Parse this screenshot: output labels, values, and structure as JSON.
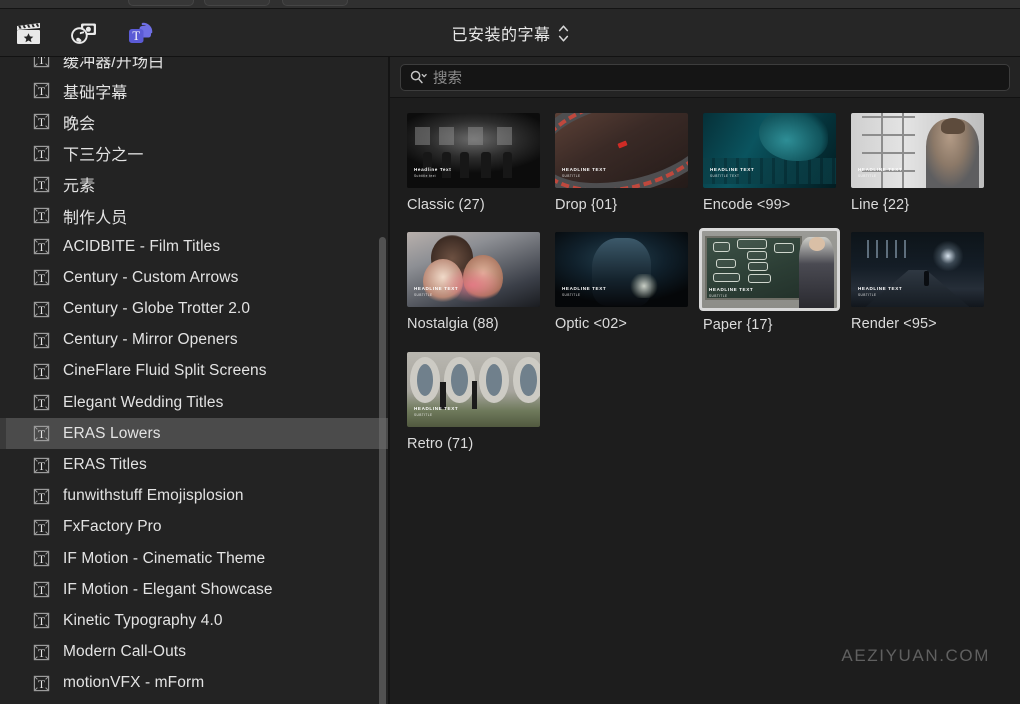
{
  "window": {
    "app_theme_bg": "#1b1b1b",
    "accent_color": "#5b5bd6"
  },
  "toolbar": {
    "icons": [
      {
        "name": "media-clapperboard-icon",
        "label": "照片和视频"
      },
      {
        "name": "audio-photos-icon",
        "label": "音频和照片"
      },
      {
        "name": "titles-generators-icon",
        "label": "字幕和发生器",
        "active": true
      }
    ],
    "browser_title": "已安装的字幕",
    "browser_title_chevron": "chevron-up-down"
  },
  "sidebar": {
    "scroll_position": "middle",
    "items": [
      {
        "label": "缓冲器/开场白",
        "icon": "title-T-icon",
        "selected": false,
        "cjk": true,
        "clipped": true
      },
      {
        "label": "基础字幕",
        "icon": "title-T-icon",
        "selected": false,
        "cjk": true
      },
      {
        "label": "晚会",
        "icon": "title-T-icon",
        "selected": false,
        "cjk": true
      },
      {
        "label": "下三分之一",
        "icon": "title-T-icon",
        "selected": false,
        "cjk": true
      },
      {
        "label": "元素",
        "icon": "title-T-icon",
        "selected": false,
        "cjk": true
      },
      {
        "label": "制作人员",
        "icon": "title-T-icon",
        "selected": false,
        "cjk": true
      },
      {
        "label": "ACIDBITE - Film Titles",
        "icon": "title-T-icon",
        "selected": false
      },
      {
        "label": "Century - Custom Arrows",
        "icon": "title-T-icon",
        "selected": false
      },
      {
        "label": "Century - Globe Trotter 2.0",
        "icon": "title-T-icon",
        "selected": false
      },
      {
        "label": "Century - Mirror Openers",
        "icon": "title-T-icon",
        "selected": false
      },
      {
        "label": "CineFlare Fluid Split Screens",
        "icon": "title-T-icon",
        "selected": false
      },
      {
        "label": "Elegant Wedding Titles",
        "icon": "title-T-icon",
        "selected": false
      },
      {
        "label": "ERAS Lowers",
        "icon": "title-T-icon",
        "selected": true
      },
      {
        "label": "ERAS Titles",
        "icon": "title-T-icon",
        "selected": false
      },
      {
        "label": "funwithstuff Emojisplosion",
        "icon": "title-T-icon",
        "selected": false
      },
      {
        "label": "FxFactory Pro",
        "icon": "title-T-icon",
        "selected": false
      },
      {
        "label": "IF Motion - Cinematic Theme",
        "icon": "title-T-icon",
        "selected": false
      },
      {
        "label": "IF Motion - Elegant Showcase",
        "icon": "title-T-icon",
        "selected": false
      },
      {
        "label": "Kinetic Typography 4.0",
        "icon": "title-T-icon",
        "selected": false
      },
      {
        "label": "Modern Call-Outs",
        "icon": "title-T-icon",
        "selected": false
      },
      {
        "label": "motionVFX - mForm",
        "icon": "title-T-icon",
        "selected": false
      }
    ]
  },
  "search": {
    "icon": "search-icon",
    "placeholder": "搜索",
    "value": ""
  },
  "grid": {
    "items": [
      {
        "label": "Classic (27)",
        "art": "a-classic",
        "headline": "Headline Text",
        "subline": "Subtitle text",
        "selected": false
      },
      {
        "label": "Drop {01}",
        "art": "a-drop",
        "headline": "HEADLINE TEXT",
        "subline": "SUBTITLE",
        "selected": false
      },
      {
        "label": "Encode <99>",
        "art": "a-encode",
        "headline": "HEADLINE TEXT",
        "subline": "SUBTITLE TEXT",
        "selected": false
      },
      {
        "label": "Line {22}",
        "art": "a-line",
        "headline": "HEADLINE TEXT",
        "subline": "SUBTITLE",
        "selected": false
      },
      {
        "label": "Nostalgia (88)",
        "art": "a-nostalgia",
        "headline": "HEADLINE TEXT",
        "subline": "SUBTITLE",
        "selected": false
      },
      {
        "label": "Optic <02>",
        "art": "a-optic",
        "headline": "HEADLINE TEXT",
        "subline": "SUBTITLE",
        "selected": false
      },
      {
        "label": "Paper {17}",
        "art": "a-paper",
        "headline": "HEADLINE TEXT",
        "subline": "SUBTITLE",
        "selected": true
      },
      {
        "label": "Render <95>",
        "art": "a-render",
        "headline": "HEADLINE TEXT",
        "subline": "SUBTITLE",
        "selected": false
      },
      {
        "label": "Retro (71)",
        "art": "a-retro",
        "headline": "HEADLINE TEXT",
        "subline": "SUBTITLE",
        "selected": false
      }
    ]
  },
  "watermark": {
    "text": "AEZIYUAN.COM"
  }
}
